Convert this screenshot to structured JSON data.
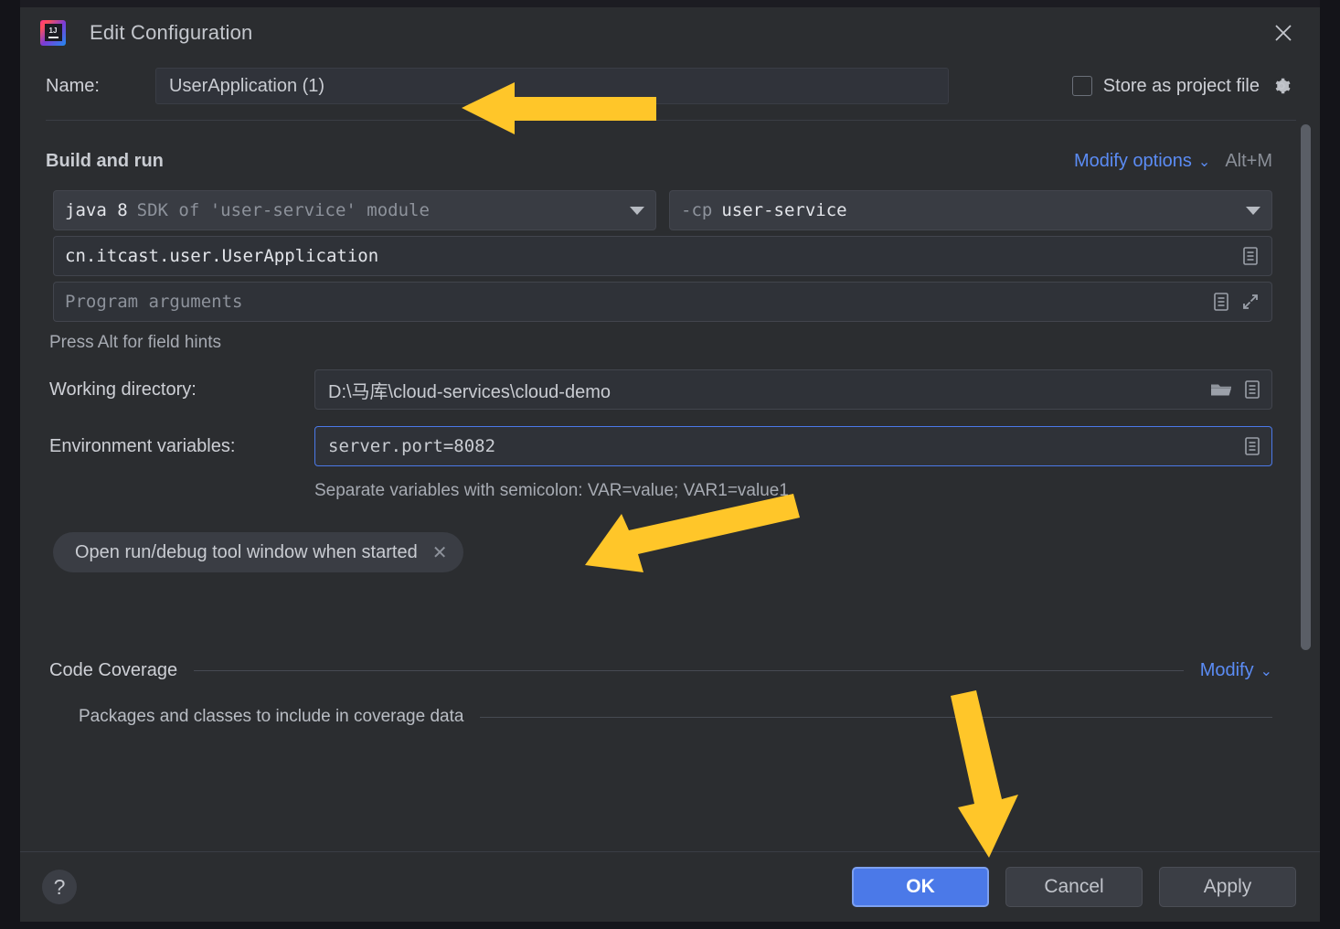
{
  "window": {
    "title": "Edit Configuration",
    "logo_icon": "intellij-idea-logo",
    "close_icon": "close-icon"
  },
  "name_row": {
    "label": "Name:",
    "value": "UserApplication (1)",
    "store_as_project_file": {
      "label": "Store as project file",
      "checked": false,
      "gear_icon": "gear-dropdown-icon"
    }
  },
  "build_and_run": {
    "title": "Build and run",
    "modify_options_link": "Modify options",
    "modify_options_chevron": "chevron-down-icon",
    "shortcut": "Alt+M",
    "jre": {
      "prefix": "java 8",
      "description": "SDK of 'user-service' module",
      "dropdown_icon": "chevron-down-icon"
    },
    "classpath": {
      "prefix": "-cp",
      "value": "user-service",
      "dropdown_icon": "chevron-down-icon"
    },
    "main_class": {
      "value": "cn.itcast.user.UserApplication",
      "expand_icon": "document-list-icon"
    },
    "program_arguments": {
      "placeholder": "Program arguments",
      "value": "",
      "document_icon": "document-list-icon",
      "expand_icon": "expand-diagonal-icon"
    },
    "field_hint": "Press Alt for field hints",
    "working_directory": {
      "label": "Working directory:",
      "value": "D:\\马库\\cloud-services\\cloud-demo",
      "folder_icon": "folder-icon",
      "document_icon": "document-list-icon"
    },
    "environment_variables": {
      "label": "Environment variables:",
      "value": "server.port=8082",
      "focused": true,
      "document_icon": "document-list-icon",
      "hint": "Separate variables with semicolon: VAR=value; VAR1=value1"
    },
    "option_tag": {
      "label": "Open run/debug tool window when started",
      "remove_icon": "close-small-icon"
    }
  },
  "code_coverage": {
    "title": "Code Coverage",
    "modify_link": "Modify",
    "modify_chevron": "chevron-down-icon",
    "subsection": "Packages and classes to include in coverage data"
  },
  "footer": {
    "help_icon": "question-mark-icon",
    "ok": "OK",
    "cancel": "Cancel",
    "apply": "Apply"
  },
  "annotations": {
    "arrow_color": "#FFC629",
    "arrow_name_field": "arrow-pointing-to-name-field",
    "arrow_env_field": "arrow-pointing-to-environment-variables",
    "arrow_ok_button": "arrow-pointing-to-ok-button"
  },
  "colors": {
    "dialog_background": "#2b2d30",
    "primary_button": "#4b79e8",
    "link": "#5b8cf5",
    "accent_arrow": "#FFC629"
  }
}
